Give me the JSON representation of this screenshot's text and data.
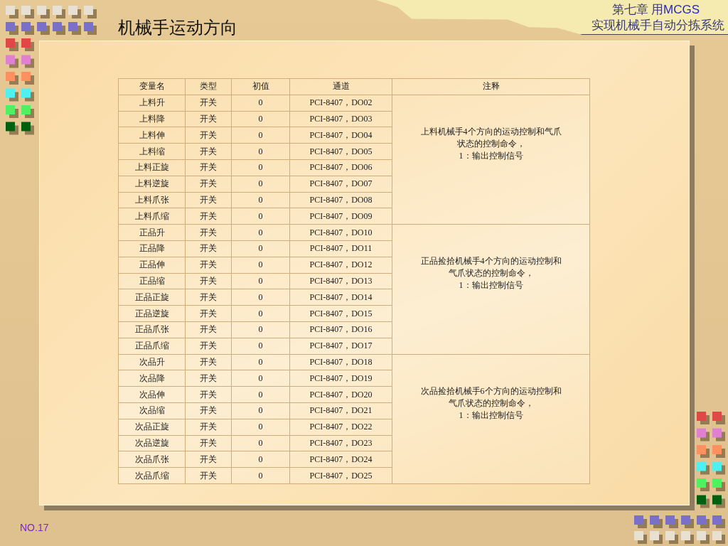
{
  "slide": {
    "title": "机械手运动方向",
    "chapter": {
      "prefix": "第七章 用",
      "highlight": "MCGS",
      "line2": "实现机械手自动分拣系统"
    },
    "page_number": "NO.17"
  },
  "table": {
    "columns": [
      "变量名",
      "类型",
      "初值",
      "通道",
      "注释"
    ],
    "groups": [
      {
        "note": [
          "上料机械手4个方向的运动控制和气爪",
          "状态的控制命令，",
          "1：输出控制信号"
        ],
        "rows": [
          [
            "上料升",
            "开关",
            "0",
            "PCI-8407，DO02"
          ],
          [
            "上料降",
            "开关",
            "0",
            "PCI-8407，DO03"
          ],
          [
            "上料伸",
            "开关",
            "0",
            "PCI-8407，DO04"
          ],
          [
            "上料缩",
            "开关",
            "0",
            "PCI-8407，DO05"
          ],
          [
            "上料正旋",
            "开关",
            "0",
            "PCI-8407，DO06"
          ],
          [
            "上料逆旋",
            "开关",
            "0",
            "PCI-8407，DO07"
          ],
          [
            "上料爪张",
            "开关",
            "0",
            "PCI-8407，DO08"
          ],
          [
            "上料爪缩",
            "开关",
            "0",
            "PCI-8407，DO09"
          ]
        ]
      },
      {
        "note": [
          "正品捡拾机械手4个方向的运动控制和",
          "气爪状态的控制命令，",
          "1：输出控制信号"
        ],
        "rows": [
          [
            "正品升",
            "开关",
            "0",
            "PCI-8407，DO10"
          ],
          [
            "正品降",
            "开关",
            "0",
            "PCI-8407，DO11"
          ],
          [
            "正品伸",
            "开关",
            "0",
            "PCI-8407，DO12"
          ],
          [
            "正品缩",
            "开关",
            "0",
            "PCI-8407，DO13"
          ],
          [
            "正品正旋",
            "开关",
            "0",
            "PCI-8407，DO14"
          ],
          [
            "正品逆旋",
            "开关",
            "0",
            "PCI-8407，DO15"
          ],
          [
            "正品爪张",
            "开关",
            "0",
            "PCI-8407，DO16"
          ],
          [
            "正品爪缩",
            "开关",
            "0",
            "PCI-8407，DO17"
          ]
        ]
      },
      {
        "note": [
          "次品捡拾机械手6个方向的运动控制和",
          "气爪状态的控制命令，",
          "1：输出控制信号"
        ],
        "rows": [
          [
            "次品升",
            "开关",
            "0",
            "PCI-8407，DO18"
          ],
          [
            "次品降",
            "开关",
            "0",
            "PCI-8407，DO19"
          ],
          [
            "次品伸",
            "开关",
            "0",
            "PCI-8407，DO20"
          ],
          [
            "次品缩",
            "开关",
            "0",
            "PCI-8407，DO21"
          ],
          [
            "次品正旋",
            "开关",
            "0",
            "PCI-8407，DO22"
          ],
          [
            "次品逆旋",
            "开关",
            "0",
            "PCI-8407，DO23"
          ],
          [
            "次品爪张",
            "开关",
            "0",
            "PCI-8407，DO24"
          ],
          [
            "次品爪缩",
            "开关",
            "0",
            "PCI-8407，DO25"
          ]
        ]
      }
    ]
  }
}
